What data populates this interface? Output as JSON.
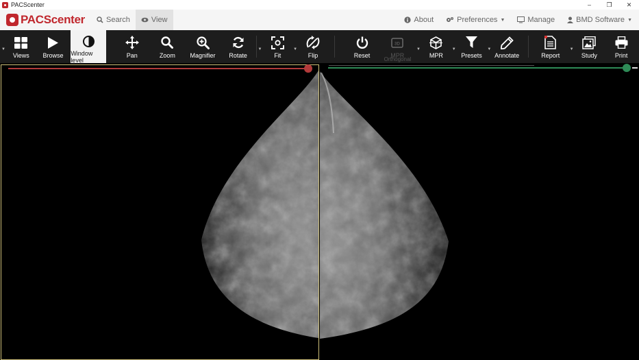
{
  "window": {
    "title": "PACScenter",
    "controls": [
      "–",
      "❐",
      "✕"
    ]
  },
  "navbar": {
    "logo_text": "PACScenter",
    "tabs": [
      {
        "label": "Search",
        "icon": "search-icon"
      },
      {
        "label": "View",
        "icon": "eye-icon",
        "active": true
      }
    ],
    "right": [
      {
        "label": "About",
        "icon": "info-icon"
      },
      {
        "label": "Preferences",
        "icon": "gears-icon",
        "dropdown": true
      },
      {
        "label": "Manage",
        "icon": "monitor-icon"
      },
      {
        "label": "BMD Software",
        "icon": "user-icon",
        "dropdown": true
      }
    ]
  },
  "toolbar": {
    "views": "Views",
    "browse": "Browse",
    "window_level": "Window level",
    "pan": "Pan",
    "zoom": "Zoom",
    "magnifier": "Magnifier",
    "rotate": "Rotate",
    "fit": "Fit",
    "flip": "Flip",
    "reset": "Reset",
    "mpr_orthogonal_top": "MPR",
    "mpr_orthogonal_bottom": "Orthogonal",
    "mpr": "MPR",
    "presets": "Presets",
    "annotate": "Annotate",
    "report": "Report",
    "study": "Study",
    "print": "Print"
  },
  "colors": {
    "brand": "#c0272d",
    "left_slider": "#b23a3a",
    "right_slider": "#2e8b57",
    "active_border": "#cfc07a"
  },
  "viewer": {
    "left_slider_value": 1.0,
    "right_slider_value": 0.98
  }
}
